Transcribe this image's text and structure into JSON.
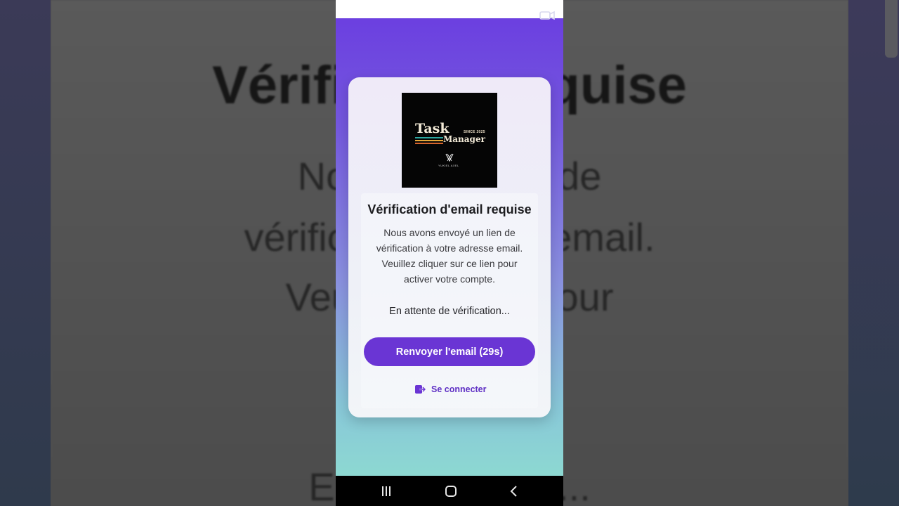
{
  "backdrop": {
    "title": "Vérificati           il requise",
    "lines": [
      "Nous av             n lien de",
      "vérification           resse email.",
      "Veuillez c           lien pour",
      "activ               mpte.",
      "En atte              ication..."
    ]
  },
  "logo": {
    "word1": "Task",
    "word2": "Manager",
    "since": "SINCE 2025",
    "author": "YUKIEL AXEL"
  },
  "card": {
    "title": "Vérification d'email requise",
    "message": "Nous avons envoyé un lien de vérification à votre adresse email. Veuillez cliquer sur ce lien pour activer votre compte.",
    "waiting": "En attente de vérification...",
    "resend_label": "Renvoyer l'email (29s)",
    "signin_label": "Se connecter"
  },
  "colors": {
    "accent": "#6a35d4",
    "link": "#5e2fc4",
    "gradient_top": "#6a3be0",
    "gradient_bottom": "#8fe0cf"
  },
  "icons": {
    "signin": "logout-arrow-icon",
    "nav_recent": "recent-apps-icon",
    "nav_home": "home-icon",
    "nav_back": "back-icon",
    "camera": "camera-icon"
  }
}
